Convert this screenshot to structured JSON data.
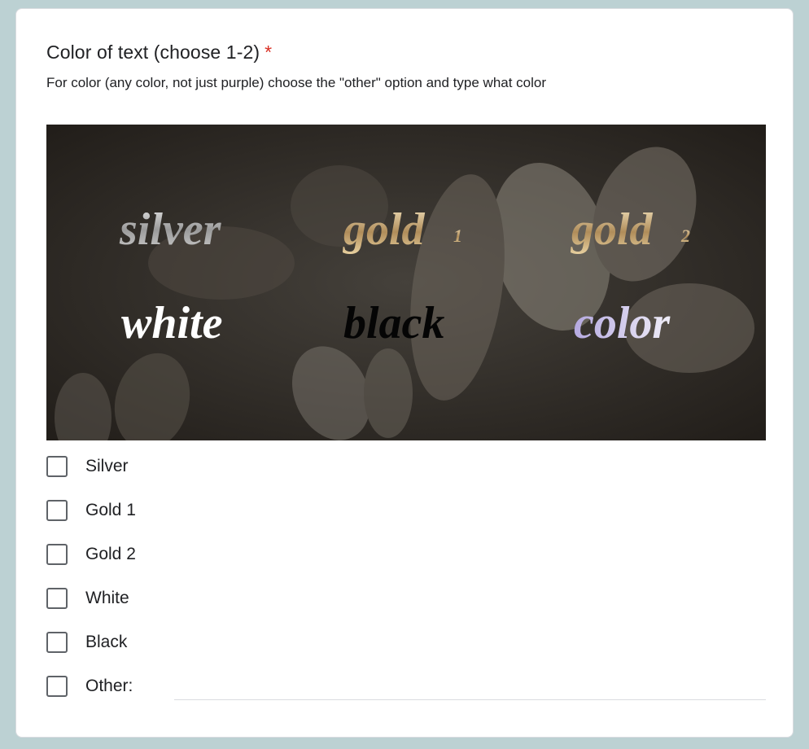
{
  "question": {
    "title": "Color of text (choose 1-2)",
    "required_mark": "*",
    "description": "For color (any color, not just purple) choose the \"other\" option and type what color"
  },
  "image_samples": {
    "silver": "silver",
    "gold1": "gold",
    "gold1_sub": "1",
    "gold2": "gold",
    "gold2_sub": "2",
    "white": "white",
    "black": "black",
    "color": "color"
  },
  "options": [
    {
      "label": "Silver",
      "checked": false
    },
    {
      "label": "Gold 1",
      "checked": false
    },
    {
      "label": "Gold 2",
      "checked": false
    },
    {
      "label": "White",
      "checked": false
    },
    {
      "label": "Black",
      "checked": false
    },
    {
      "label": "Other:",
      "checked": false
    }
  ],
  "other_value": "",
  "colors": {
    "page_background": "#bcd1d3",
    "card_background": "#ffffff",
    "required": "#d93025",
    "checkbox_border": "#5f6368"
  }
}
